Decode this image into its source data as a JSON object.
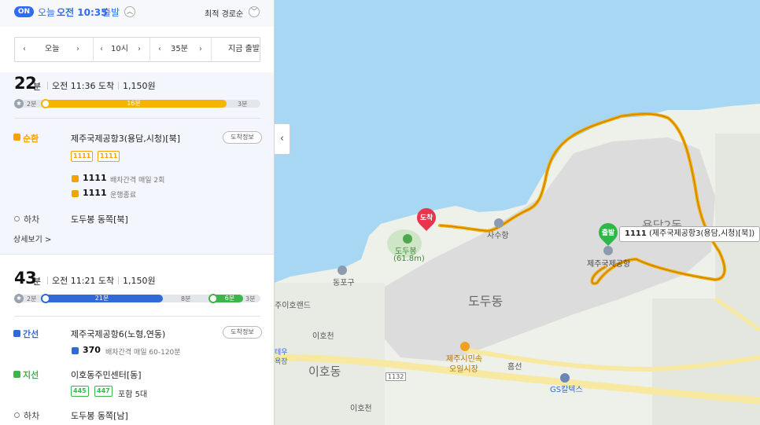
{
  "header": {
    "on_badge": "ON",
    "departure_label": "오늘",
    "departure_time": "오전 10:35",
    "departure_suffix": "출발",
    "sort_label": "최적 경로순"
  },
  "time_selector": {
    "day": "오늘",
    "hour": "10시",
    "minute": "35분",
    "now_button": "지금 출발"
  },
  "routes": [
    {
      "duration_num": "22",
      "duration_unit": "분",
      "arrival": "오전 11:36 도착",
      "fare": "1,150원",
      "progress": {
        "walk_start": "2분",
        "ride": "16분",
        "walk_end": "3분",
        "ride_color": "#f5b400"
      },
      "legs": {
        "mode": "순환",
        "mode_color": "#f5a300",
        "stop": "제주국제공항3(용담,시청)[북]",
        "info_button": "도착정보",
        "chips": [
          "1111",
          "1111"
        ],
        "bus_rows": [
          {
            "num": "1111",
            "status": "배차간격 매일 2회"
          },
          {
            "num": "1111",
            "status": "운행종료"
          }
        ],
        "alight_label": "하차",
        "alight_stop": "도두봉 동쪽[북]"
      },
      "detail_link": "상세보기 >"
    },
    {
      "duration_num": "43",
      "duration_unit": "분",
      "arrival": "오전 11:21 도착",
      "fare": "1,150원",
      "progress": {
        "walk_start": "2분",
        "ride1": "21분",
        "transfer": "8분",
        "ride2": "6분",
        "walk_end": "3분",
        "ride1_color": "#2f6ad8",
        "ride2_color": "#3cb54a"
      },
      "legs": {
        "mode1": "간선",
        "mode1_color": "#2f6ad8",
        "stop1": "제주국제공항6(노형,연동)",
        "info_button": "도착정보",
        "bus1": {
          "num": "370",
          "status": "배차간격 매일 60-120분"
        },
        "mode2": "지선",
        "mode2_color": "#3cb54a",
        "stop2": "이호동주민센터[동]",
        "chips2": [
          "445",
          "447"
        ],
        "chips2_note": "포함 5대",
        "alight_label": "하차",
        "alight_stop": "도두봉 동쪽[남]"
      }
    }
  ],
  "map": {
    "arrival_pin": "도착",
    "departure_pin": "출발",
    "departure_tooltip_bold": "1111",
    "departure_tooltip_rest": "(제주국제공항3(용담,시청)[북])",
    "labels": {
      "airport": "제주국제공항",
      "dodu": "도두동",
      "doduport": "사수항",
      "dudubong": "도두봉",
      "dudubong_height": "(61.8m)",
      "dodugu": "동포구",
      "iho_land": "주이호랜드",
      "ihocheon": "이호천",
      "ihodong": "이호동",
      "ihocheon2": "이호천",
      "market1": "제주시민속",
      "market2": "오일시장",
      "hospital": "홈선",
      "gas": "GS칼텍스",
      "road_no": "1132",
      "yongdam": "용담2동",
      "jetaw1": "테우",
      "jetaw2": "욕장"
    },
    "route_color": "#f5a800"
  }
}
